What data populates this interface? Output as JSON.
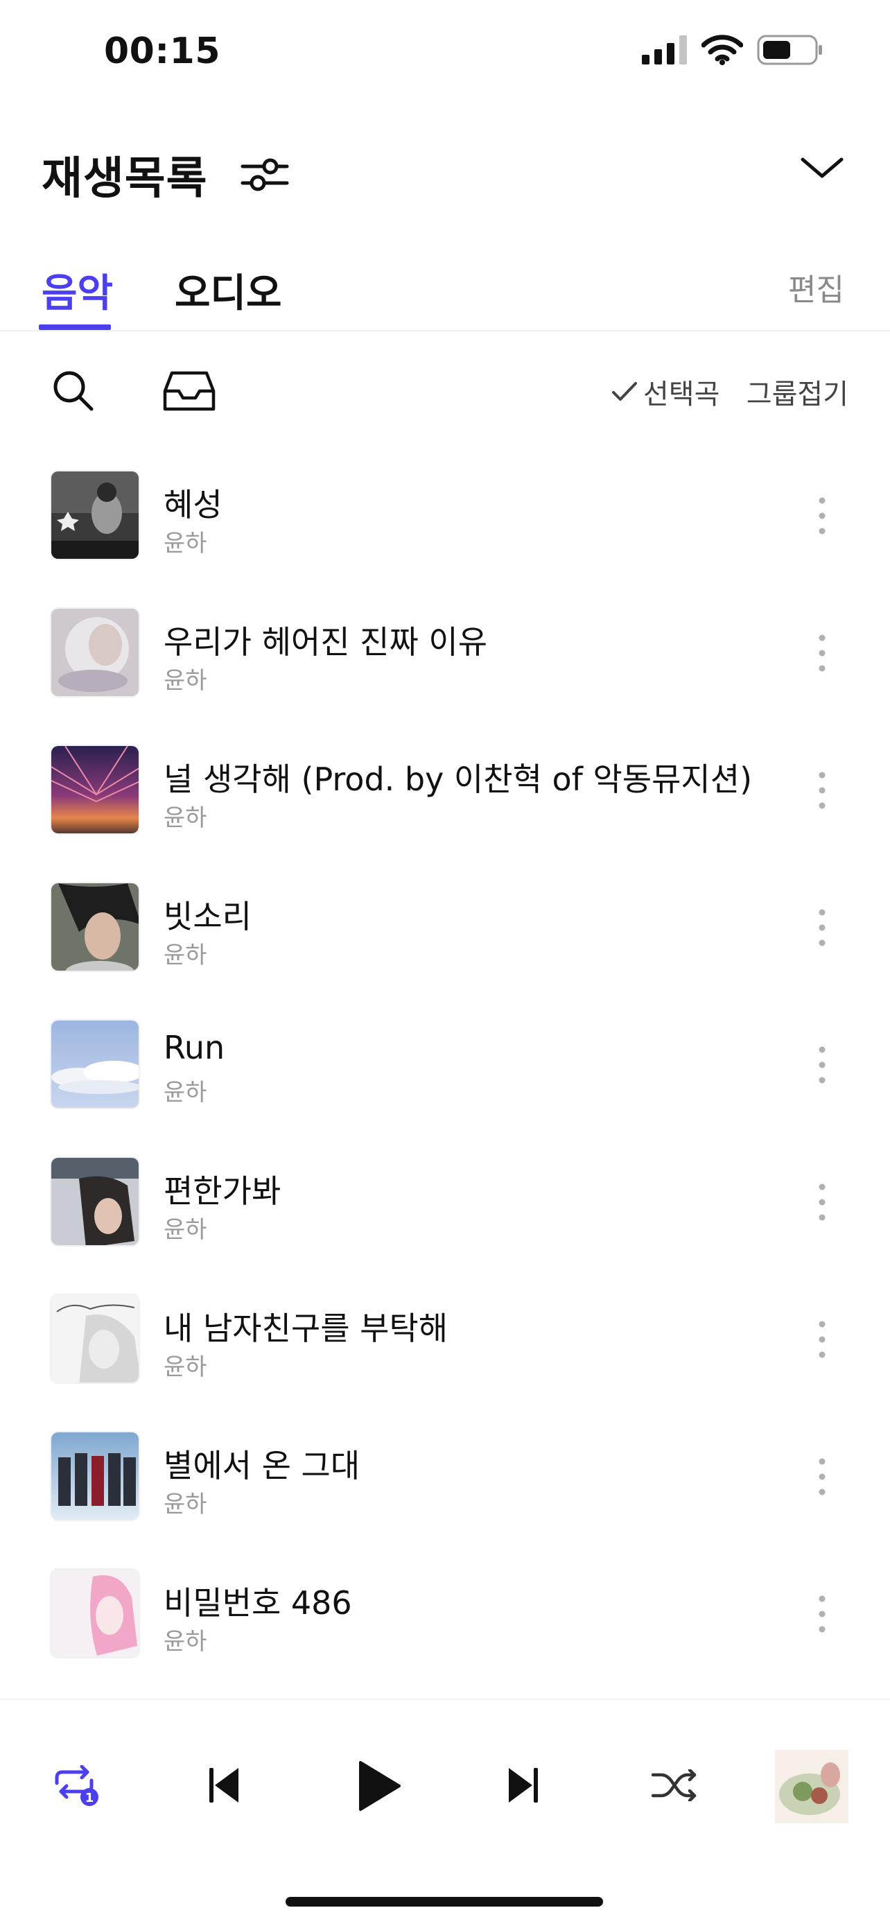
{
  "status_bar": {
    "time": "00:15"
  },
  "header": {
    "title": "재생목록"
  },
  "tabs": [
    {
      "label": "음악",
      "active": true
    },
    {
      "label": "오디오",
      "active": false
    }
  ],
  "edit_label": "편집",
  "toolbar": {
    "select_label": "선택곡",
    "group_label": "그룹접기"
  },
  "songs": [
    {
      "title": "혜성",
      "artist": "윤하"
    },
    {
      "title": "우리가 헤어진 진짜 이유",
      "artist": "윤하"
    },
    {
      "title": "널 생각해 (Prod. by 이찬혁 of 악동뮤지션)",
      "artist": "윤하"
    },
    {
      "title": "빗소리",
      "artist": "윤하"
    },
    {
      "title": "Run",
      "artist": "윤하"
    },
    {
      "title": "편한가봐",
      "artist": "윤하"
    },
    {
      "title": "내 남자친구를 부탁해",
      "artist": "윤하"
    },
    {
      "title": "별에서 온 그대",
      "artist": "윤하"
    },
    {
      "title": "비밀번호 486",
      "artist": "윤하"
    }
  ],
  "player": {
    "repeat_badge": "1"
  },
  "colors": {
    "accent": "#4b3ff0",
    "muted": "#9a9a9a"
  }
}
